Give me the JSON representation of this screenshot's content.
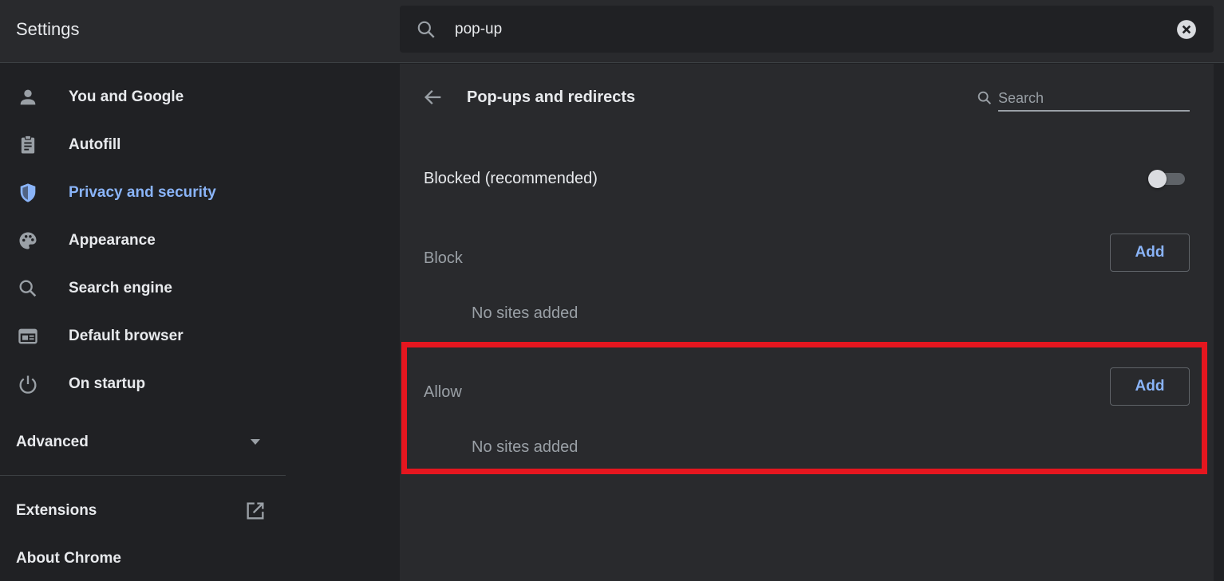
{
  "header": {
    "title": "Settings",
    "search_value": "pop-up"
  },
  "sidebar": {
    "items": [
      {
        "label": "You and Google",
        "icon": "person-icon"
      },
      {
        "label": "Autofill",
        "icon": "clipboard-icon"
      },
      {
        "label": "Privacy and security",
        "icon": "shield-icon",
        "active": true
      },
      {
        "label": "Appearance",
        "icon": "palette-icon"
      },
      {
        "label": "Search engine",
        "icon": "search-icon"
      },
      {
        "label": "Default browser",
        "icon": "browser-icon"
      },
      {
        "label": "On startup",
        "icon": "power-icon"
      }
    ],
    "advanced": "Advanced",
    "extensions": "Extensions",
    "about": "About Chrome"
  },
  "main": {
    "title": "Pop-ups and redirects",
    "search_placeholder": "Search",
    "blocked_label": "Blocked (recommended)",
    "blocked_enabled": false,
    "block_section": {
      "label": "Block",
      "add_label": "Add",
      "empty": "No sites added"
    },
    "allow_section": {
      "label": "Allow",
      "add_label": "Add",
      "empty": "No sites added"
    }
  },
  "colors": {
    "accent": "#8ab4f8",
    "highlight": "#e5161f",
    "background": "#202124",
    "card": "#292a2d"
  }
}
